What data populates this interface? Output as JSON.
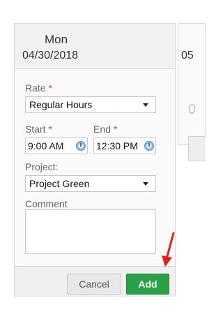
{
  "day": {
    "name": "Mon",
    "date": "04/30/2018"
  },
  "form": {
    "rate": {
      "label": "Rate",
      "required_mark": "*",
      "value": "Regular Hours"
    },
    "start": {
      "label": "Start",
      "required_mark": "*",
      "value": "9:00 AM"
    },
    "end": {
      "label": "End",
      "required_mark": "*",
      "value": "12:30 PM"
    },
    "project": {
      "label": "Project:",
      "value": "Project Green"
    },
    "comment": {
      "label": "Comment",
      "value": ""
    }
  },
  "actions": {
    "cancel_label": "Cancel",
    "add_label": "Add"
  },
  "neighbor": {
    "date_partial": "05",
    "value_partial": "0"
  },
  "icons": {
    "dropdown": "chevron-down-icon",
    "time": "clock-icon",
    "annotation": "red-arrow-icon"
  },
  "colors": {
    "required": "#e04646",
    "add_button": "#2aa148",
    "arrow": "#e11f1f"
  }
}
